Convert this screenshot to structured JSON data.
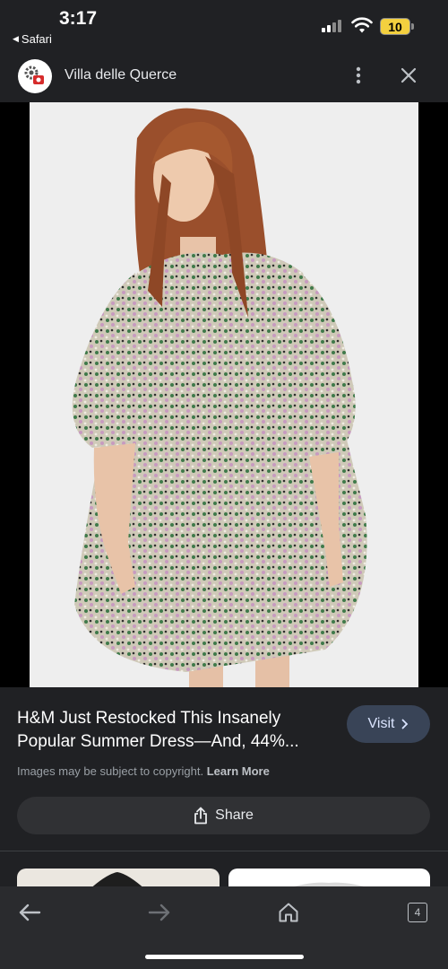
{
  "status_bar": {
    "time": "3:17",
    "back_app": "Safari",
    "battery": "10"
  },
  "header": {
    "site_name": "Villa delle Querce"
  },
  "result": {
    "title": "H&M Just Restocked This Insanely Popular Summer Dress—And, 44%...",
    "visit_label": "Visit",
    "copyright_text": "Images may be subject to copyright.",
    "learn_more": "Learn More",
    "share_label": "Share"
  },
  "toolbar": {
    "tab_count": "4"
  },
  "icons": {
    "back": "back-arrow-icon",
    "forward": "forward-arrow-icon",
    "home": "home-icon",
    "tabs": "tabs-icon",
    "menu": "more-vert-icon",
    "close": "close-icon",
    "share": "share-icon"
  },
  "colors": {
    "background": "#202124",
    "visit_button": "#394457",
    "share_button": "#303134",
    "battery": "#f4d03f"
  }
}
